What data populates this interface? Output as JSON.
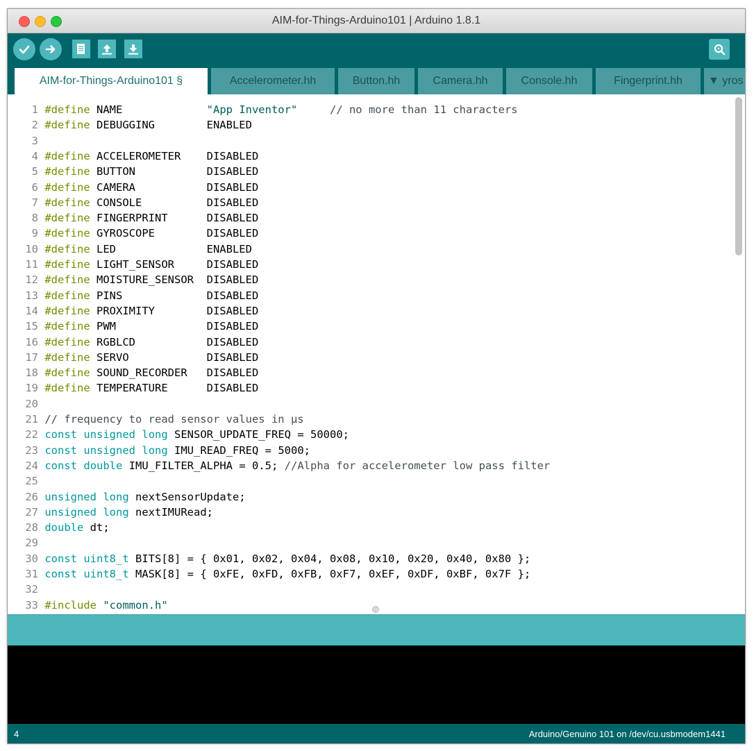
{
  "window": {
    "title": "AIM-for-Things-Arduino101 | Arduino 1.8.1"
  },
  "tabs": [
    {
      "label": "AIM-for-Things-Arduino101 §",
      "active": true
    },
    {
      "label": "Accelerometer.hh"
    },
    {
      "label": "Button.hh"
    },
    {
      "label": "Camera.hh"
    },
    {
      "label": "Console.hh"
    },
    {
      "label": "Fingerprint.hh"
    },
    {
      "label": "▼ yros"
    }
  ],
  "code_lines": [
    {
      "n": "1",
      "parts": [
        [
          "kw",
          "#define"
        ],
        [
          "code",
          " NAME             "
        ],
        [
          "str",
          "\"App Inventor\""
        ],
        [
          "code",
          "     "
        ],
        [
          "cm",
          "// no more than 11 characters"
        ]
      ]
    },
    {
      "n": "2",
      "parts": [
        [
          "kw",
          "#define"
        ],
        [
          "code",
          " DEBUGGING        ENABLED"
        ]
      ]
    },
    {
      "n": "3",
      "parts": []
    },
    {
      "n": "4",
      "parts": [
        [
          "kw",
          "#define"
        ],
        [
          "code",
          " ACCELEROMETER    DISABLED"
        ]
      ]
    },
    {
      "n": "5",
      "parts": [
        [
          "kw",
          "#define"
        ],
        [
          "code",
          " BUTTON           DISABLED"
        ]
      ]
    },
    {
      "n": "6",
      "parts": [
        [
          "kw",
          "#define"
        ],
        [
          "code",
          " CAMERA           DISABLED"
        ]
      ]
    },
    {
      "n": "7",
      "parts": [
        [
          "kw",
          "#define"
        ],
        [
          "code",
          " CONSOLE          DISABLED"
        ]
      ]
    },
    {
      "n": "8",
      "parts": [
        [
          "kw",
          "#define"
        ],
        [
          "code",
          " FINGERPRINT      DISABLED"
        ]
      ]
    },
    {
      "n": "9",
      "parts": [
        [
          "kw",
          "#define"
        ],
        [
          "code",
          " GYROSCOPE        DISABLED"
        ]
      ]
    },
    {
      "n": "10",
      "parts": [
        [
          "kw",
          "#define"
        ],
        [
          "code",
          " LED              ENABLED"
        ]
      ]
    },
    {
      "n": "11",
      "parts": [
        [
          "kw",
          "#define"
        ],
        [
          "code",
          " LIGHT_SENSOR     DISABLED"
        ]
      ]
    },
    {
      "n": "12",
      "parts": [
        [
          "kw",
          "#define"
        ],
        [
          "code",
          " MOISTURE_SENSOR  DISABLED"
        ]
      ]
    },
    {
      "n": "13",
      "parts": [
        [
          "kw",
          "#define"
        ],
        [
          "code",
          " PINS             DISABLED"
        ]
      ]
    },
    {
      "n": "14",
      "parts": [
        [
          "kw",
          "#define"
        ],
        [
          "code",
          " PROXIMITY        DISABLED"
        ]
      ]
    },
    {
      "n": "15",
      "parts": [
        [
          "kw",
          "#define"
        ],
        [
          "code",
          " PWM              DISABLED"
        ]
      ]
    },
    {
      "n": "16",
      "parts": [
        [
          "kw",
          "#define"
        ],
        [
          "code",
          " RGBLCD           DISABLED"
        ]
      ]
    },
    {
      "n": "17",
      "parts": [
        [
          "kw",
          "#define"
        ],
        [
          "code",
          " SERVO            DISABLED"
        ]
      ]
    },
    {
      "n": "18",
      "parts": [
        [
          "kw",
          "#define"
        ],
        [
          "code",
          " SOUND_RECORDER   DISABLED"
        ]
      ]
    },
    {
      "n": "19",
      "parts": [
        [
          "kw",
          "#define"
        ],
        [
          "code",
          " TEMPERATURE      DISABLED"
        ]
      ]
    },
    {
      "n": "20",
      "parts": []
    },
    {
      "n": "21",
      "parts": [
        [
          "cm",
          "// frequency to read sensor values in µs"
        ]
      ]
    },
    {
      "n": "22",
      "parts": [
        [
          "ty",
          "const"
        ],
        [
          "code",
          " "
        ],
        [
          "ty",
          "unsigned"
        ],
        [
          "code",
          " "
        ],
        [
          "ty",
          "long"
        ],
        [
          "code",
          " SENSOR_UPDATE_FREQ = 50000;"
        ]
      ]
    },
    {
      "n": "23",
      "parts": [
        [
          "ty",
          "const"
        ],
        [
          "code",
          " "
        ],
        [
          "ty",
          "unsigned"
        ],
        [
          "code",
          " "
        ],
        [
          "ty",
          "long"
        ],
        [
          "code",
          " IMU_READ_FREQ = 5000;"
        ]
      ]
    },
    {
      "n": "24",
      "parts": [
        [
          "ty",
          "const"
        ],
        [
          "code",
          " "
        ],
        [
          "ty",
          "double"
        ],
        [
          "code",
          " IMU_FILTER_ALPHA = 0.5; "
        ],
        [
          "cm",
          "//Alpha for accelerometer low pass filter"
        ]
      ]
    },
    {
      "n": "25",
      "parts": []
    },
    {
      "n": "26",
      "parts": [
        [
          "ty",
          "unsigned"
        ],
        [
          "code",
          " "
        ],
        [
          "ty",
          "long"
        ],
        [
          "code",
          " nextSensorUpdate;"
        ]
      ]
    },
    {
      "n": "27",
      "parts": [
        [
          "ty",
          "unsigned"
        ],
        [
          "code",
          " "
        ],
        [
          "ty",
          "long"
        ],
        [
          "code",
          " nextIMURead;"
        ]
      ]
    },
    {
      "n": "28",
      "parts": [
        [
          "ty",
          "double"
        ],
        [
          "code",
          " dt;"
        ]
      ]
    },
    {
      "n": "29",
      "parts": []
    },
    {
      "n": "30",
      "parts": [
        [
          "ty",
          "const"
        ],
        [
          "code",
          " "
        ],
        [
          "ty",
          "uint8_t"
        ],
        [
          "code",
          " BITS[8] = { 0x01, 0x02, 0x04, 0x08, 0x10, 0x20, 0x40, 0x80 };"
        ]
      ]
    },
    {
      "n": "31",
      "parts": [
        [
          "ty",
          "const"
        ],
        [
          "code",
          " "
        ],
        [
          "ty",
          "uint8_t"
        ],
        [
          "code",
          " MASK[8] = { 0xFE, 0xFD, 0xFB, 0xF7, 0xEF, 0xDF, 0xBF, 0x7F };"
        ]
      ]
    },
    {
      "n": "32",
      "parts": []
    },
    {
      "n": "33",
      "parts": [
        [
          "kw",
          "#include"
        ],
        [
          "code",
          " "
        ],
        [
          "str",
          "\"common.h\""
        ]
      ]
    }
  ],
  "footer": {
    "line_number": "4",
    "board": "Arduino/Genuino 101 on /dev/cu.usbmodem1441"
  },
  "toolbar": {
    "icons": [
      "verify-icon",
      "upload-icon",
      "new-icon",
      "open-icon",
      "save-icon",
      "serial-monitor-icon"
    ]
  },
  "colors": {
    "toolbar": "#006468",
    "button": "#4db7bb",
    "keyword": "#728e00",
    "type": "#00979c",
    "console": "#000000"
  }
}
